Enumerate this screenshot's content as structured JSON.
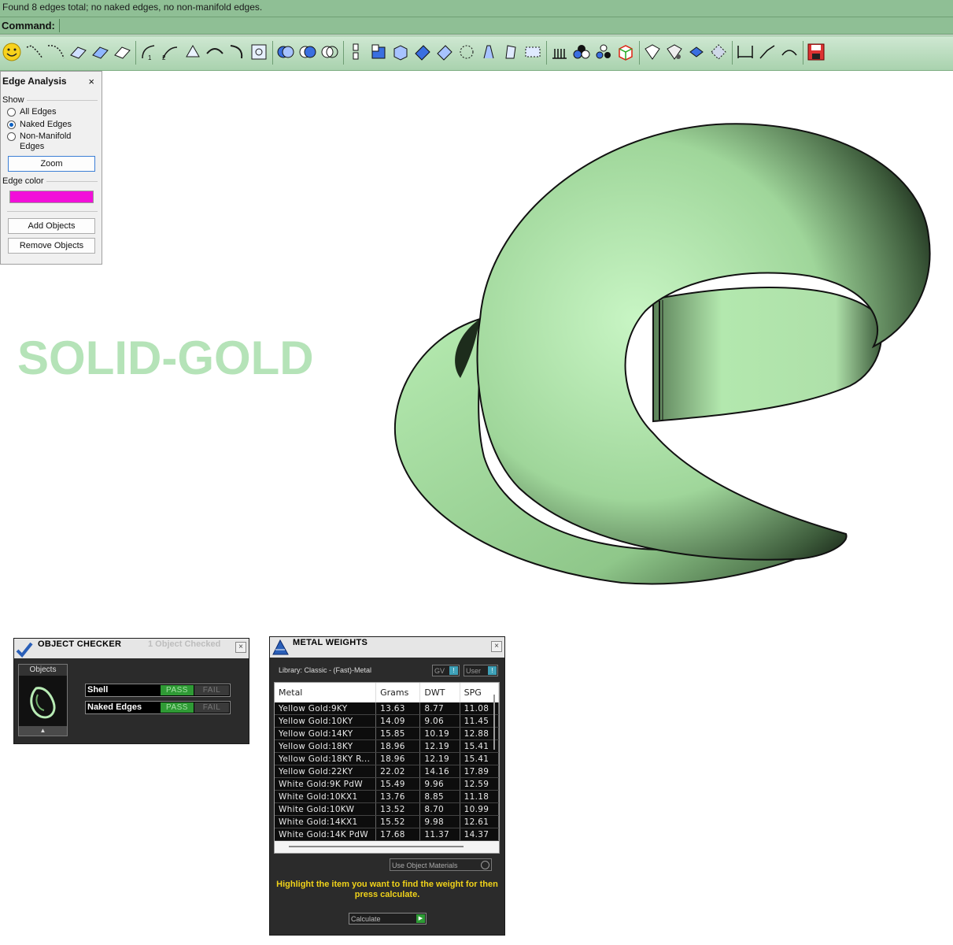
{
  "status": {
    "message": "Found 8 edges total; no naked edges, no non-manifold edges."
  },
  "command": {
    "label": "Command:"
  },
  "toolbar": {
    "icons": [
      "smiley-icon",
      "curve-icon",
      "curve-icon",
      "surface-icon",
      "surface-icon",
      "surface-icon",
      "fillet-icon",
      "blend-icon",
      "loft-icon",
      "sweep-icon",
      "snap-icon",
      "boolean-icon",
      "boolean-icon",
      "boolean-icon",
      "split-icon",
      "box-icon",
      "box-icon",
      "surface-icon",
      "surface-icon",
      "points-icon",
      "curve-icon",
      "curve-icon",
      "frame-icon",
      "array-icon",
      "render-icon",
      "render-icon",
      "cube-icon",
      "gem-icon",
      "gem-icon",
      "gem-icon",
      "gem-icon",
      "dimension-icon",
      "curve-icon",
      "curve-icon",
      "save-icon"
    ]
  },
  "edge_analysis": {
    "title": "Edge Analysis",
    "close": "×",
    "show_label": "Show",
    "options": [
      "All Edges",
      "Naked Edges",
      "Non-Manifold",
      "Edges"
    ],
    "selected": "Naked Edges",
    "zoom": "Zoom",
    "edge_color_label": "Edge color",
    "edge_color": "#f20fd9",
    "add_objects": "Add Objects",
    "remove_objects": "Remove Objects"
  },
  "viewport": {
    "label": "SOLID-GOLD",
    "model_color": "#b8ecb5"
  },
  "object_checker": {
    "title": "OBJECT CHECKER",
    "count": "1  Object Checked",
    "close": "×",
    "objects_label": "Objects",
    "up": "▲",
    "checks": [
      {
        "name": "Shell",
        "pass": "PASS",
        "fail": "FAIL"
      },
      {
        "name": "Naked Edges",
        "pass": "PASS",
        "fail": "FAIL"
      }
    ]
  },
  "metal_weights": {
    "title": "METAL WEIGHTS",
    "close": "×",
    "library": "Library: Classic - (Fast)-Metal",
    "toggle_gv": "GV",
    "toggle_user": "User",
    "columns": [
      "Metal",
      "Grams",
      "DWT",
      "SPG"
    ],
    "rows": [
      [
        "Yellow Gold:9KY",
        "13.63",
        "8.77",
        "11.08"
      ],
      [
        "Yellow Gold:10KY",
        "14.09",
        "9.06",
        "11.45"
      ],
      [
        "Yellow Gold:14KY",
        "15.85",
        "10.19",
        "12.88"
      ],
      [
        "Yellow Gold:18KY",
        "18.96",
        "12.19",
        "15.41"
      ],
      [
        "Yellow Gold:18KY R...",
        "18.96",
        "12.19",
        "15.41"
      ],
      [
        "Yellow Gold:22KY",
        "22.02",
        "14.16",
        "17.89"
      ],
      [
        "White Gold:9K PdW",
        "15.49",
        "9.96",
        "12.59"
      ],
      [
        "White Gold:10KX1",
        "13.76",
        "8.85",
        "11.18"
      ],
      [
        "White Gold:10KW",
        "13.52",
        "8.70",
        "10.99"
      ],
      [
        "White Gold:14KX1",
        "15.52",
        "9.98",
        "12.61"
      ],
      [
        "White Gold:14K PdW",
        "17.68",
        "11.37",
        "14.37"
      ]
    ],
    "use_object_materials": "Use Object Materials",
    "hint": "Highlight the item you want to find the weight for then press calculate.",
    "calculate": "Calculate"
  }
}
